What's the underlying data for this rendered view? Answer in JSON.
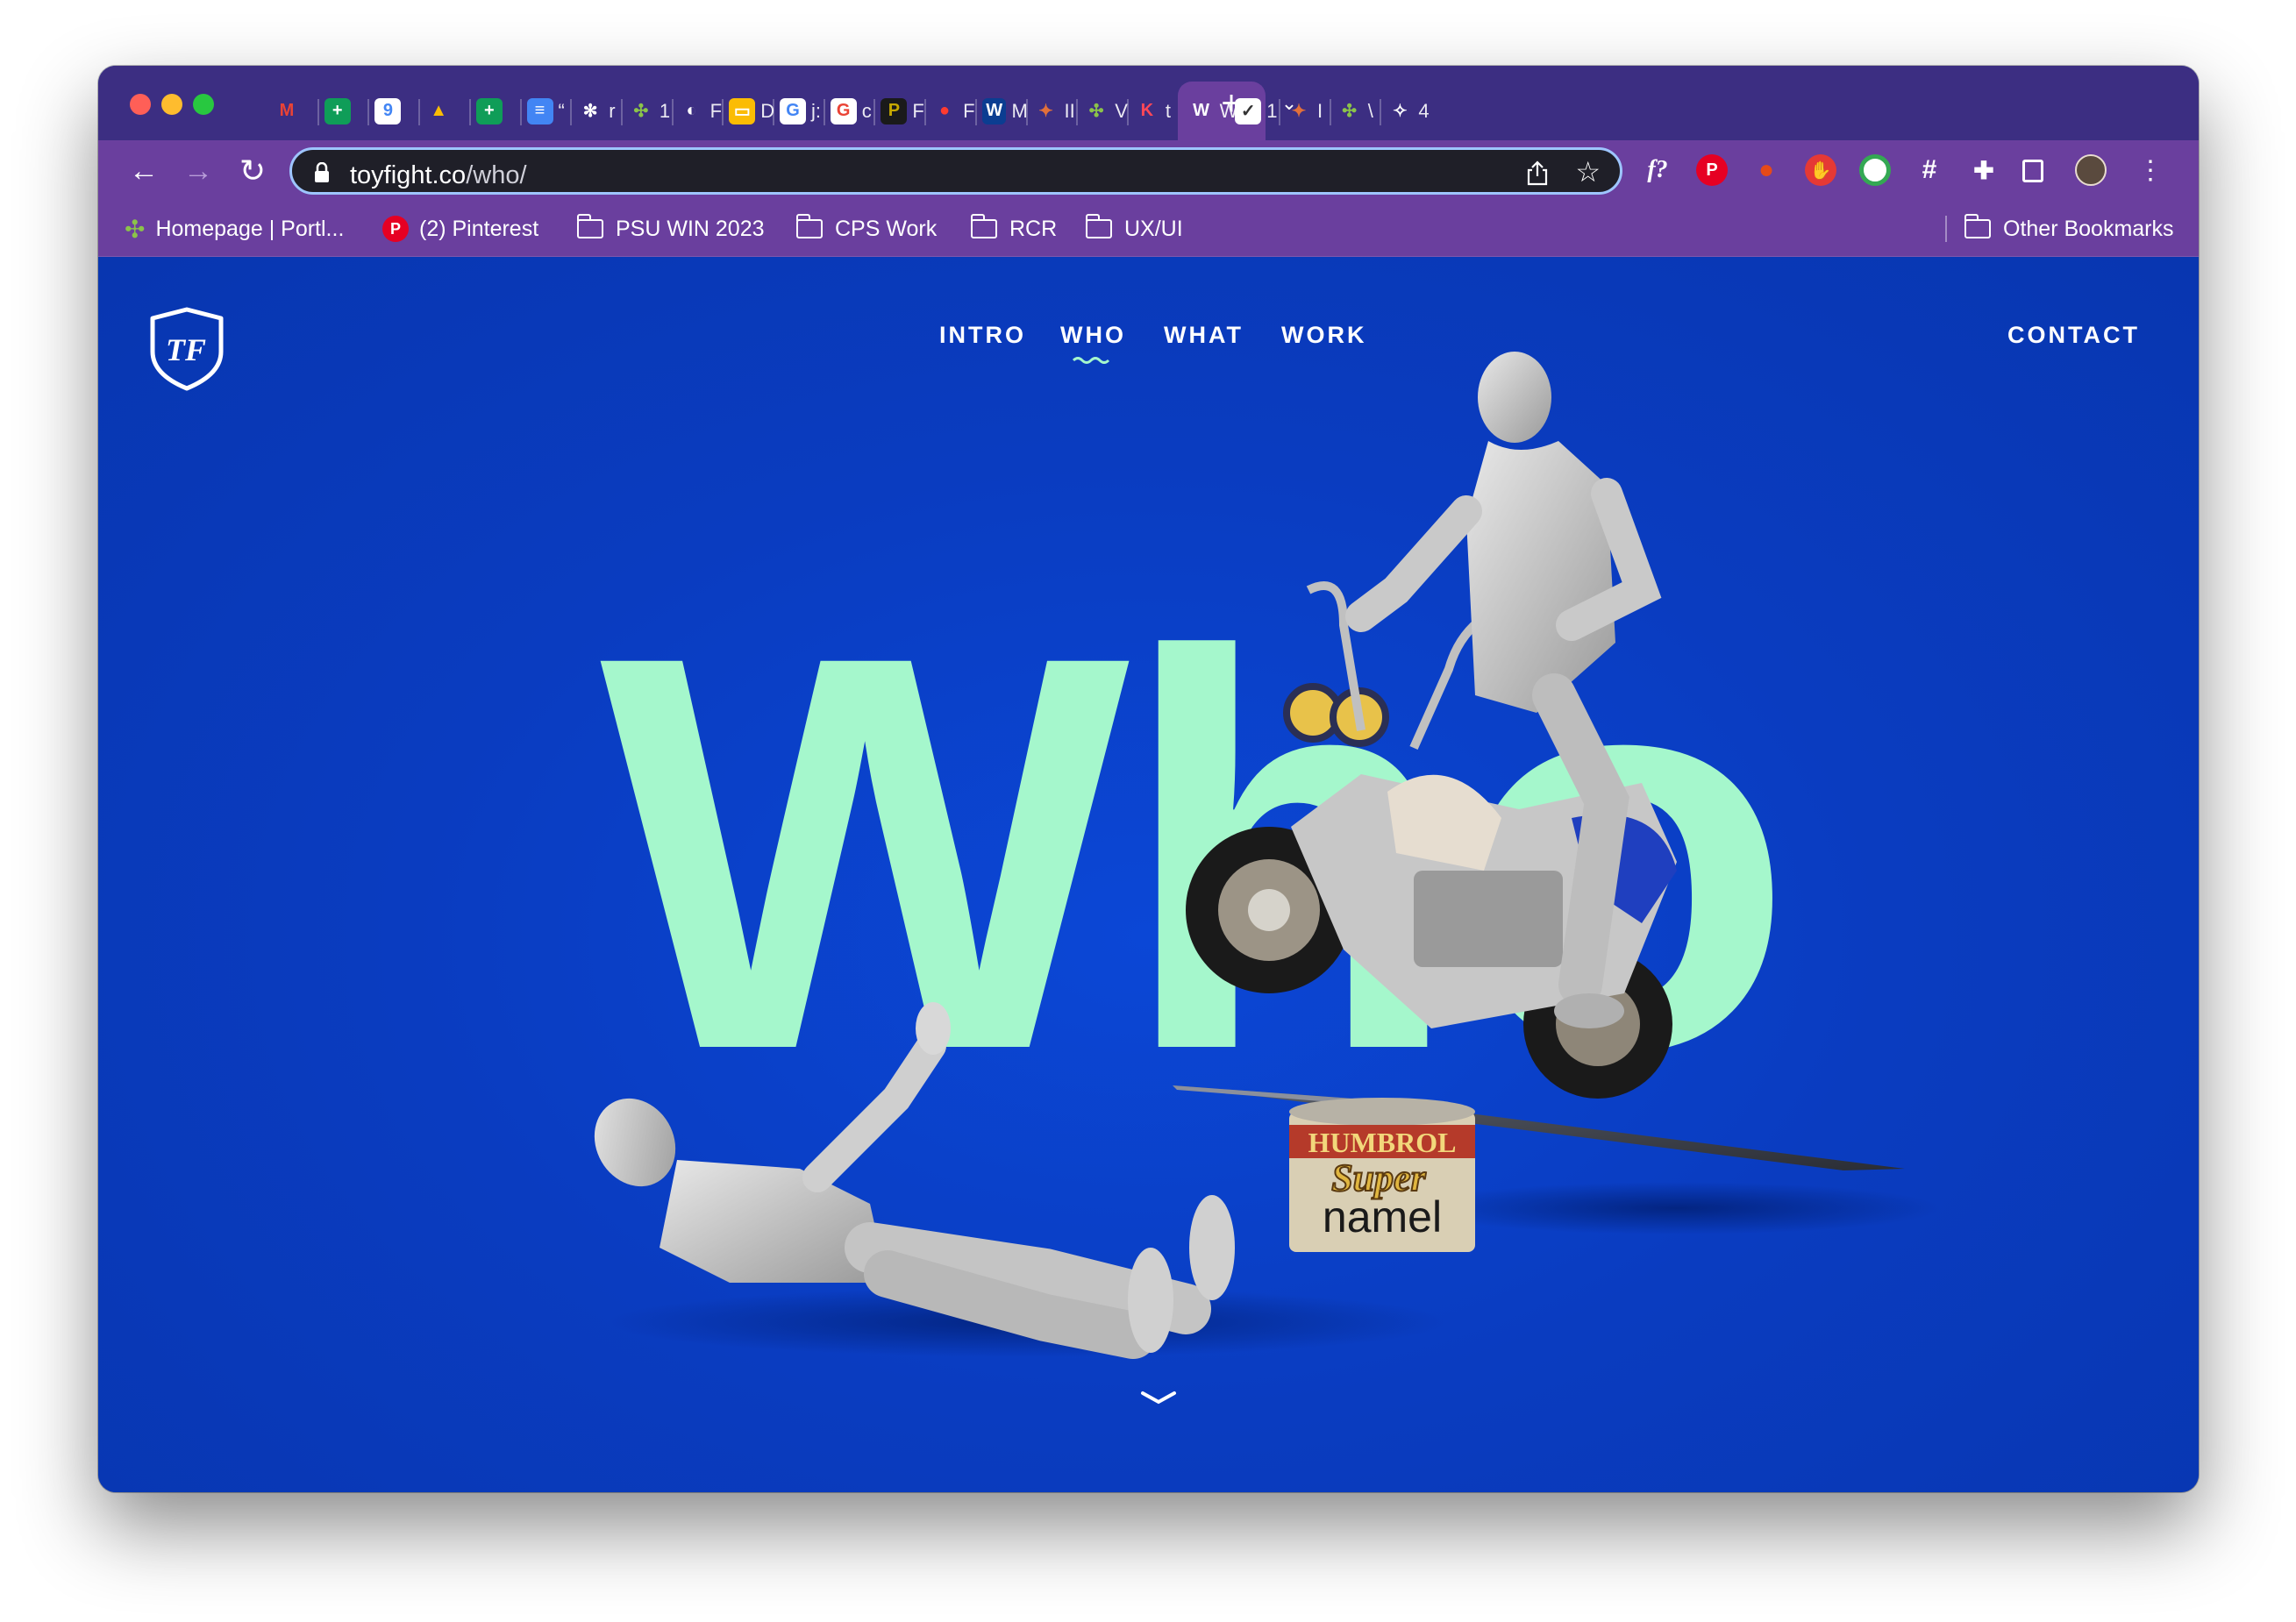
{
  "browser": {
    "tabs": [
      {
        "fav": "M",
        "label": "",
        "color": "#ea4335",
        "bg": "transparent",
        "fg": "#ea4335"
      },
      {
        "fav": "+",
        "label": "",
        "color": "#0f9d58",
        "bg": "#0f9d58",
        "fg": "#ffffff"
      },
      {
        "fav": "9",
        "label": "",
        "color": "#4285f4",
        "bg": "#ffffff",
        "fg": "#4285f4"
      },
      {
        "fav": "▲",
        "label": "",
        "color": "#fbbc04",
        "bg": "transparent",
        "fg": "#fbbc04"
      },
      {
        "fav": "+",
        "label": "",
        "color": "#0f9d58",
        "bg": "#0f9d58",
        "fg": "#ffffff"
      },
      {
        "fav": "≡",
        "label": "“",
        "color": "#4285f4",
        "bg": "#4285f4",
        "fg": "#ffffff"
      },
      {
        "fav": "✻",
        "label": "r",
        "color": "#ffffff",
        "bg": "transparent",
        "fg": "#ffffff"
      },
      {
        "fav": "✣",
        "label": "1",
        "color": "#8bc34a",
        "bg": "transparent",
        "fg": "#8bc34a"
      },
      {
        "fav": "◐",
        "label": "F",
        "color": "#ffffff",
        "bg": "transparent",
        "fg": "#ffffff"
      },
      {
        "fav": "▭",
        "label": "D",
        "color": "#fbbc04",
        "bg": "#fbbc04",
        "fg": "#ffffff"
      },
      {
        "fav": "G",
        "label": "j:",
        "color": "#ffffff",
        "bg": "#ffffff",
        "fg": "#4285f4"
      },
      {
        "fav": "G",
        "label": "c",
        "color": "#ffffff",
        "bg": "#ffffff",
        "fg": "#ea4335"
      },
      {
        "fav": "P",
        "label": "F",
        "color": "#1a1a1a",
        "bg": "#1a1a1a",
        "fg": "#c6a800"
      },
      {
        "fav": "●",
        "label": "F",
        "color": "#ff3b30",
        "bg": "transparent",
        "fg": "#ff3b30"
      },
      {
        "fav": "W",
        "label": "M",
        "color": "#2a7fff",
        "bg": "#0b3d91",
        "fg": "#ffffff"
      },
      {
        "fav": "✦",
        "label": "II",
        "color": "#e2703a",
        "bg": "transparent",
        "fg": "#e2703a"
      },
      {
        "fav": "✣",
        "label": "V",
        "color": "#8bc34a",
        "bg": "transparent",
        "fg": "#8bc34a"
      },
      {
        "fav": "K",
        "label": "t",
        "color": "#ff4757",
        "bg": "transparent",
        "fg": "#ff4757"
      },
      {
        "fav": "W",
        "label": "W",
        "color": "#ffffff",
        "bg": "transparent",
        "fg": "#ffffff",
        "active": true
      },
      {
        "fav": "✓",
        "label": "1",
        "color": "#ffffff",
        "bg": "#ffffff",
        "fg": "#333333"
      },
      {
        "fav": "✦",
        "label": "I",
        "color": "#e2703a",
        "bg": "transparent",
        "fg": "#e2703a"
      },
      {
        "fav": "✣",
        "label": "\\",
        "color": "#8bc34a",
        "bg": "transparent",
        "fg": "#8bc34a"
      },
      {
        "fav": "✧",
        "label": "4",
        "color": "#ffffff",
        "bg": "transparent",
        "fg": "#ffffff"
      }
    ],
    "url_host": "toyfight.co",
    "url_path": "/who/",
    "bookmarks": [
      {
        "label": "Homepage | Portl...",
        "icon": "portl-icon"
      },
      {
        "label": "(2) Pinterest",
        "icon": "pinterest-icon"
      },
      {
        "label": "PSU WIN 2023",
        "icon": "folder-icon"
      },
      {
        "label": "CPS Work",
        "icon": "folder-icon"
      },
      {
        "label": "RCR",
        "icon": "folder-icon"
      },
      {
        "label": "UX/UI",
        "icon": "folder-icon"
      }
    ],
    "other_bookmarks": "Other Bookmarks",
    "extensions": [
      "f?",
      "P",
      "pin",
      "stop",
      "chrome",
      "grid",
      "puzzle",
      "sidebar",
      "avatar",
      "more"
    ]
  },
  "site": {
    "nav": [
      "INTRO",
      "WHO",
      "WHAT",
      "WORK"
    ],
    "active_nav": "WHO",
    "contact": "CONTACT",
    "headline": "Who",
    "logo_text": "TF",
    "can_label_1": "HUMBROL",
    "can_label_2": "Super",
    "can_label_3": "namel",
    "colors": {
      "bg": "#0a3fc0",
      "accent": "#a5f7cc"
    }
  }
}
